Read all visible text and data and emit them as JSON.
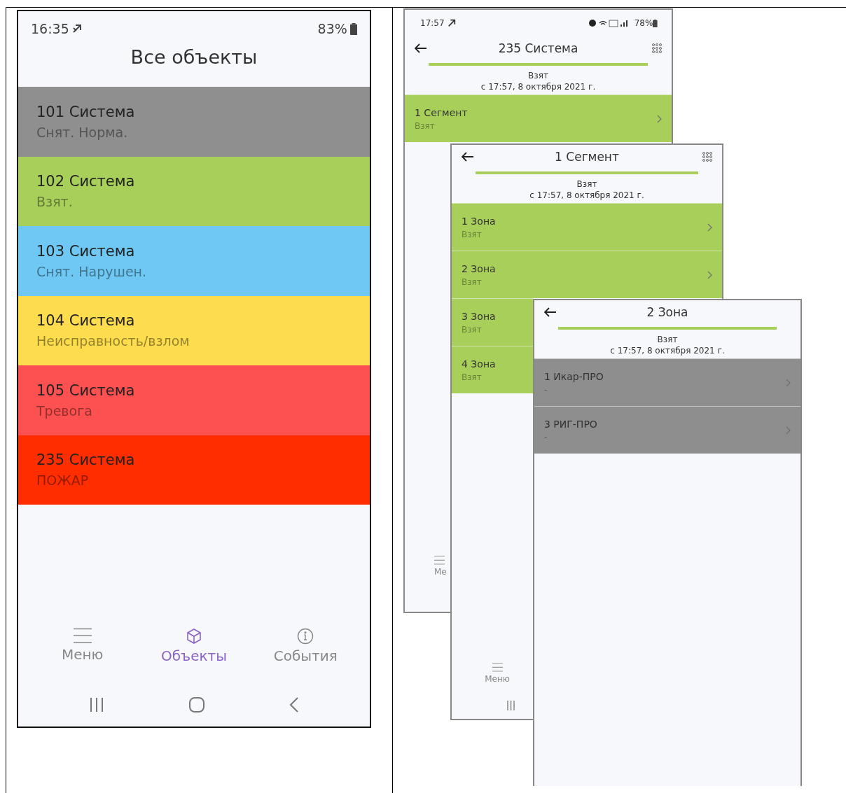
{
  "left_phone": {
    "status_bar": {
      "time": "16:35",
      "battery": "83%"
    },
    "title": "Все объекты",
    "objects": [
      {
        "name": "101 Система",
        "status": "Снят. Норма.",
        "color": "#8f8f8f"
      },
      {
        "name": "102 Система",
        "status": "Взят.",
        "color": "#a8cf5a"
      },
      {
        "name": "103 Система",
        "status": "Снят. Нарушен.",
        "color": "#6ec8f3"
      },
      {
        "name": "104 Система",
        "status": "Неисправность/взлом",
        "color": "#fddc4e"
      },
      {
        "name": "105 Система",
        "status": "Тревога",
        "color": "#fd5050"
      },
      {
        "name": "235 Система",
        "status": "ПОЖАР",
        "color": "#ff2d00"
      }
    ],
    "bottom_tabs": [
      {
        "kind": "menu",
        "label": "Меню",
        "selected": false
      },
      {
        "kind": "objects",
        "label": "Объекты",
        "selected": true
      },
      {
        "kind": "events",
        "label": "События",
        "selected": false
      }
    ]
  },
  "stacked_screens": [
    {
      "status_bar": {
        "time": "17:57",
        "battery": "78%"
      },
      "title": "235 Система",
      "grid_button": true,
      "state": "Взят",
      "since": "с 17:57, 8 октября 2021 г.",
      "rows": [
        {
          "name": "1 Сегмент",
          "status": "Взят",
          "color": "#a8cf5a",
          "chevron": true
        }
      ],
      "bottom_tab": {
        "label": "Ме"
      }
    },
    {
      "title": "1 Сегмент",
      "grid_button": true,
      "state": "Взят",
      "since": "с 17:57, 8 октября 2021 г.",
      "rows": [
        {
          "name": "1 Зона",
          "status": "Взят",
          "color": "#a8cf5a",
          "chevron": true
        },
        {
          "name": "2 Зона",
          "status": "Взят",
          "color": "#a8cf5a",
          "chevron": true
        },
        {
          "name": "3 Зона",
          "status": "Взят",
          "color": "#a8cf5a",
          "chevron": false
        },
        {
          "name": "4 Зона",
          "status": "Взят",
          "color": "#a8cf5a",
          "chevron": false
        }
      ],
      "bottom_tab": {
        "label": "Меню"
      },
      "recents_key": true
    },
    {
      "title": "2 Зона",
      "state": "Взят",
      "since": "с 17:57, 8 октября 2021 г.",
      "rows": [
        {
          "name": "1 Икар-ПРО",
          "status": "-",
          "color": "#8e8e8e",
          "chevron": true
        },
        {
          "name": "3 РИГ-ПРО",
          "status": "-",
          "color": "#8e8e8e",
          "chevron": true
        }
      ]
    }
  ]
}
